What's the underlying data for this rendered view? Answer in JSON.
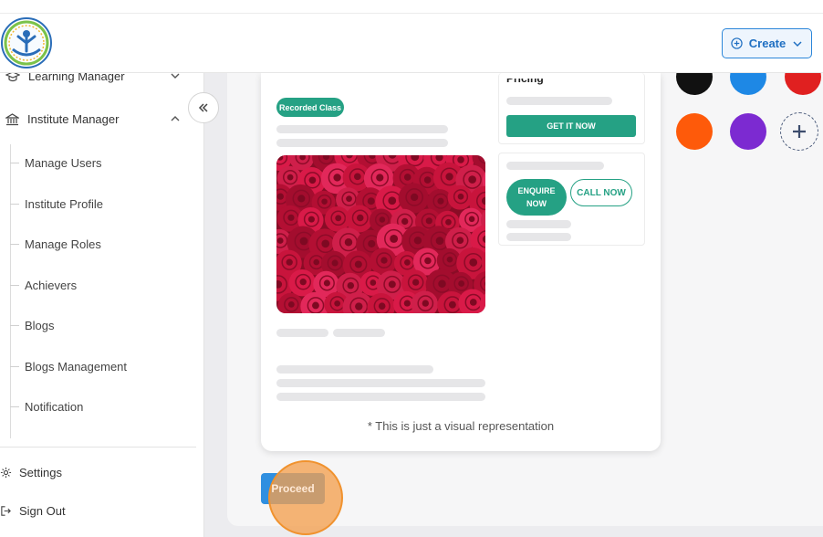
{
  "header": {
    "create_label": "Create",
    "create_icon": "plus-circle-icon",
    "create_chevron_icon": "chevron-down-icon"
  },
  "sidebar": {
    "learning_manager": "Learning Manager",
    "institute_manager": "Institute Manager",
    "sub_items": [
      "Manage Users",
      "Institute Profile",
      "Manage Roles",
      "Achievers",
      "Blogs",
      "Blogs Management",
      "Notification"
    ],
    "settings": "Settings",
    "sign_out": "Sign Out"
  },
  "preview": {
    "badge": "Recorded Class",
    "pricing_heading": "Pricing",
    "get_it_now": "GET IT NOW",
    "enquire_now": "ENQUIRE NOW",
    "call_now": "CALL NOW",
    "caption": "* This is just a visual representation"
  },
  "swatches": {
    "colors": [
      "#111111",
      "#1e88e5",
      "#e02020",
      "#fe5a0a",
      "#7c2ad1"
    ],
    "add_icon": "plus-icon"
  },
  "actions": {
    "proceed": "Proceed"
  }
}
